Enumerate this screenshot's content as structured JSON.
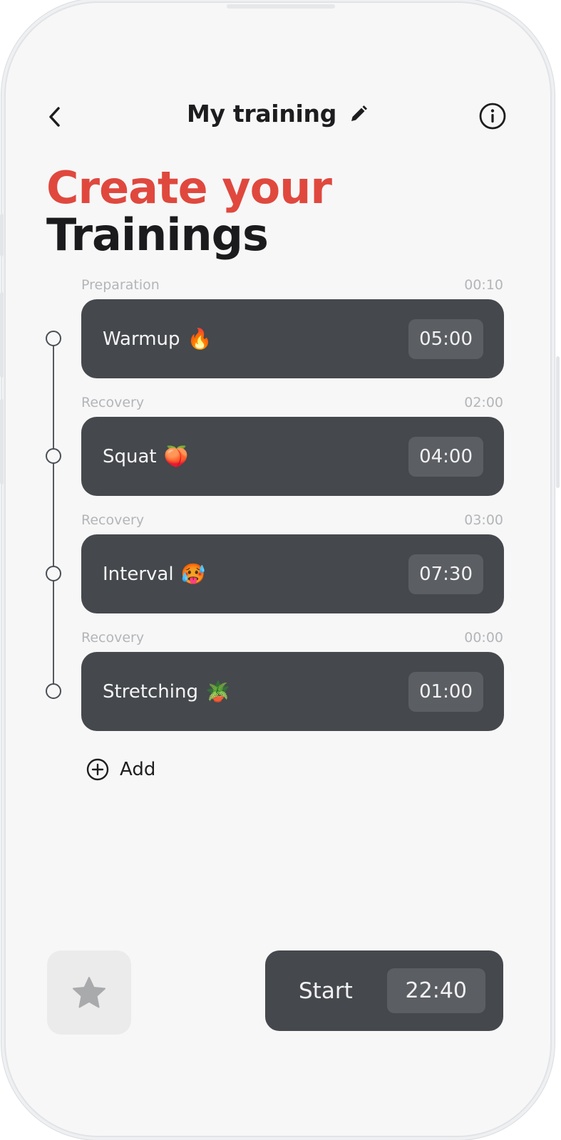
{
  "header": {
    "title": "My training",
    "back_icon": "chevron-left-icon",
    "edit_icon": "pencil-icon",
    "info_icon": "info-circle-icon"
  },
  "headline": {
    "line1": "Create your",
    "line2": "Trainings",
    "accent_color": "#e0483e"
  },
  "trainings": [
    {
      "phase": "Preparation",
      "phase_time": "00:10",
      "name": "Warmup",
      "emoji": "🔥",
      "duration": "05:00"
    },
    {
      "phase": "Recovery",
      "phase_time": "02:00",
      "name": "Squat",
      "emoji": "🍑",
      "duration": "04:00"
    },
    {
      "phase": "Recovery",
      "phase_time": "03:00",
      "name": "Interval",
      "emoji": "🥵",
      "duration": "07:30"
    },
    {
      "phase": "Recovery",
      "phase_time": "00:00",
      "name": "Stretching",
      "emoji": "🪴",
      "duration": "01:00"
    }
  ],
  "add": {
    "label": "Add",
    "icon": "plus-circle-icon"
  },
  "footer": {
    "favorite_icon": "star-icon",
    "start_label": "Start",
    "total_time": "22:40"
  },
  "colors": {
    "card_bg": "#45484c",
    "chip_bg": "#5b5e63",
    "background": "#f7f7f7"
  }
}
